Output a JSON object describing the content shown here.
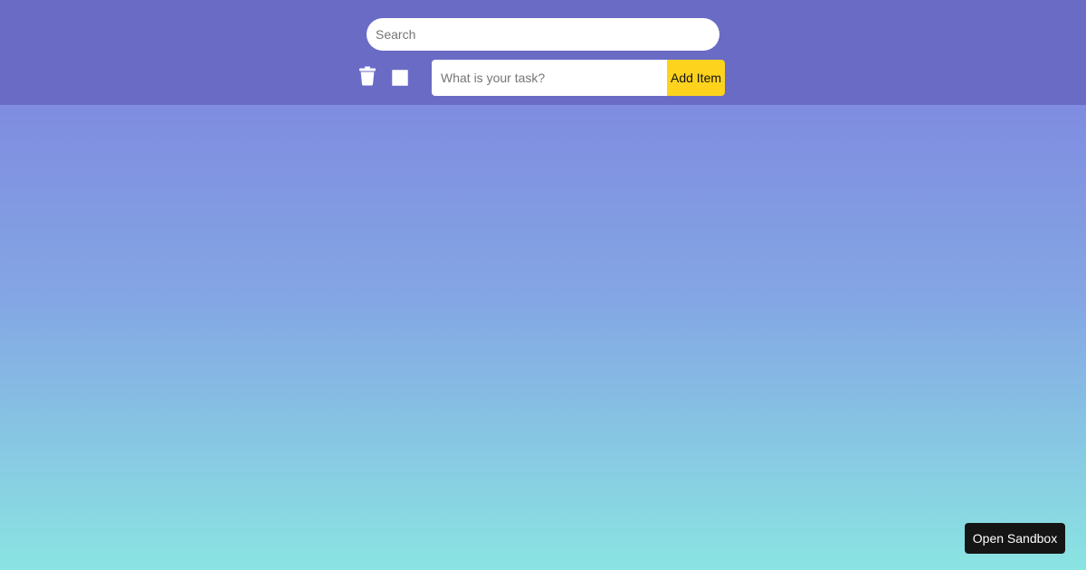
{
  "header": {
    "search": {
      "placeholder": "Search",
      "value": ""
    },
    "delete_icon": "trash-icon",
    "select_all": {
      "checked": false
    },
    "task_input": {
      "placeholder": "What is your task?",
      "value": ""
    },
    "add_button_label": "Add Item"
  },
  "footer": {
    "open_sandbox_label": "Open Sandbox"
  },
  "colors": {
    "header_bg": "#6a6bc5",
    "accent_button": "#fdd31e",
    "gradient_top": "#7f8ce0",
    "gradient_bottom": "#8ae4e2",
    "sandbox_button_bg": "#151515"
  }
}
